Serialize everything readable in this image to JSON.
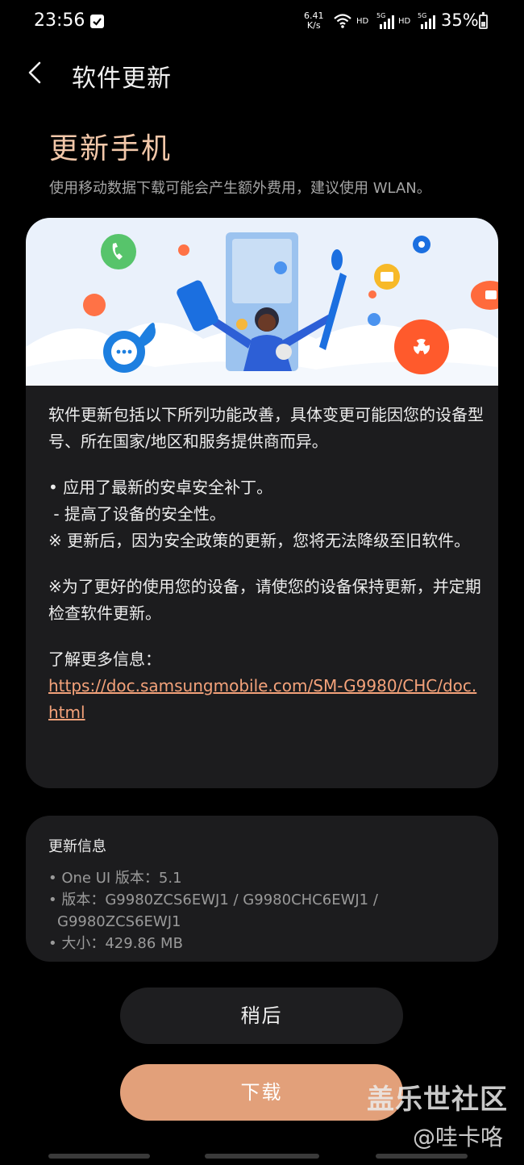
{
  "status_bar": {
    "time": "23:56",
    "net_speed_value": "6.41",
    "net_speed_unit": "K/s",
    "hd_1": "HD",
    "sig_1": "5G",
    "hd_2": "HD",
    "sig_2": "5G",
    "battery": "35%"
  },
  "header": {
    "title": "软件更新"
  },
  "update": {
    "heading": "更新手机",
    "data_warning": "使用移动数据下载可能会产生额外费用，建议使用 WLAN。"
  },
  "release_notes": {
    "intro": "软件更新包括以下所列功能改善，具体变更可能因您的设备型号、所在国家/地区和服务提供商而异。",
    "item_1": "• 应用了最新的安卓安全补丁。",
    "item_2": " - 提高了设备的安全性。",
    "item_3": "※ 更新后，因为安全政策的更新，您将无法降级至旧软件。",
    "advice": "※为了更好的使用您的设备，请使您的设备保持更新，并定期检查软件更新。",
    "more_info_label": "了解更多信息：",
    "link": "https://doc.samsungmobile.com/SM-G9980/CHC/doc.html"
  },
  "update_info": {
    "heading": "更新信息",
    "one_ui": "• One UI 版本：5.1",
    "version_line_1": "• 版本：G9980ZCS6EWJ1 / G9980CHC6EWJ1 /",
    "version_line_2": "G9980ZCS6EWJ1",
    "size": "• 大小：429.86 MB"
  },
  "buttons": {
    "later": "稍后",
    "download": "下载"
  },
  "watermark": {
    "line_1": "盖乐世社区",
    "line_2": "@哇卡咯"
  },
  "colors": {
    "accent": "#e2a07a",
    "heading": "#f2c7a9",
    "link": "#f4a27a",
    "card": "#1c1c1e"
  },
  "icons": [
    "back-arrow-icon",
    "wifi-icon",
    "signal-icon",
    "battery-icon",
    "phone-icon",
    "chat-icon",
    "gear-icon",
    "folder-icon",
    "flower-icon"
  ]
}
